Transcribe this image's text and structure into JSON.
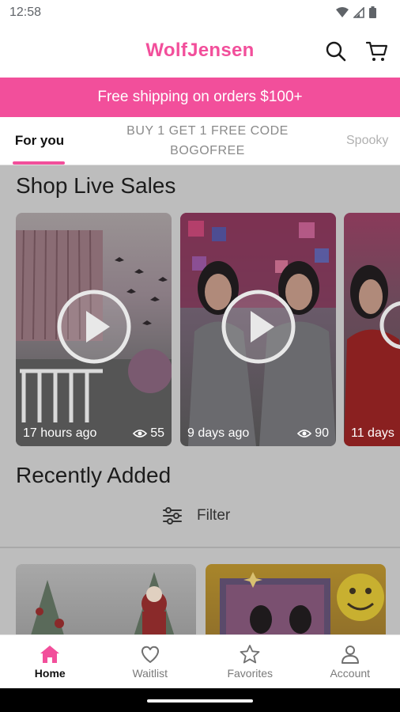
{
  "status_bar": {
    "time": "12:58"
  },
  "app_bar": {
    "title": "WolfJensen"
  },
  "banner": {
    "text": "Free shipping on orders $100+"
  },
  "tabs": [
    {
      "label": "For you"
    },
    {
      "label": "BUY 1 GET 1 FREE CODE BOGOFREE"
    },
    {
      "label": "Spooky"
    }
  ],
  "live_sales": {
    "title": "Shop Live Sales",
    "cards": [
      {
        "time": "17 hours ago",
        "views": "55"
      },
      {
        "time": "9 days ago",
        "views": "90"
      },
      {
        "time": "11 days"
      }
    ]
  },
  "recently_added": {
    "title": "Recently Added",
    "filter_label": "Filter"
  },
  "bottom_nav": [
    {
      "label": "Home"
    },
    {
      "label": "Waitlist"
    },
    {
      "label": "Favorites"
    },
    {
      "label": "Account"
    }
  ],
  "colors": {
    "brand": "#f24f9b",
    "overlay_bg": "#bdbdbd",
    "active_nav": "#f24f9b"
  },
  "icons": [
    "search-icon",
    "cart-icon",
    "play-icon",
    "eye-icon",
    "filter-icon",
    "home-icon",
    "heart-icon",
    "star-icon",
    "person-icon"
  ]
}
